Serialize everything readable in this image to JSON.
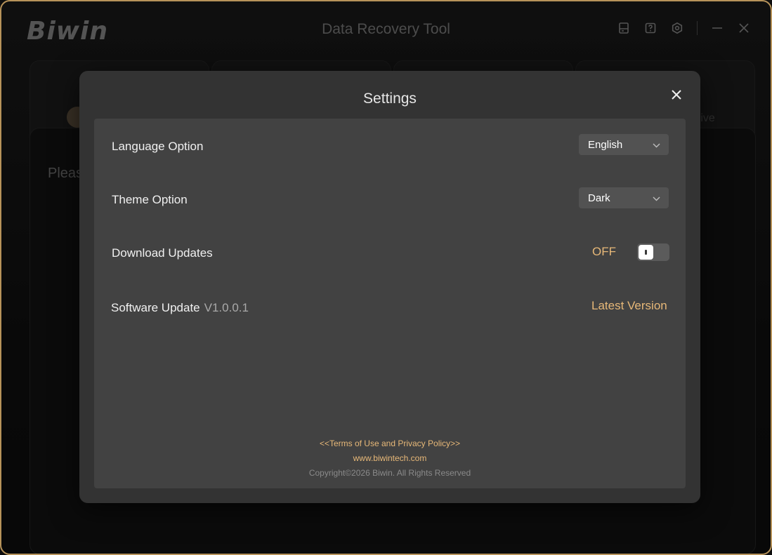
{
  "app": {
    "logo": "Biwin",
    "title": "Data Recovery Tool",
    "title_icons": [
      "disk-icon",
      "help-icon",
      "settings-icon",
      "minimize-icon",
      "close-icon"
    ]
  },
  "background": {
    "please_text": "Pleas",
    "drive_text": "rive"
  },
  "settings": {
    "title": "Settings",
    "language": {
      "label": "Language Option",
      "value": "English"
    },
    "theme": {
      "label": "Theme Option",
      "value": "Dark"
    },
    "download_updates": {
      "label": "Download Updates",
      "state": "OFF",
      "enabled": false
    },
    "software_update": {
      "label": "Software Update",
      "version": "V1.0.0.1",
      "status": "Latest Version"
    },
    "footer": {
      "terms": "<<Terms of Use and Privacy Policy>>",
      "website": "www.biwintech.com",
      "copyright": "Copyright©2026 Biwin. All Rights Reserved"
    }
  },
  "colors": {
    "accent": "#e7b878",
    "frame": "#b7935a",
    "modal_bg": "#333333",
    "panel_bg": "#424242"
  }
}
